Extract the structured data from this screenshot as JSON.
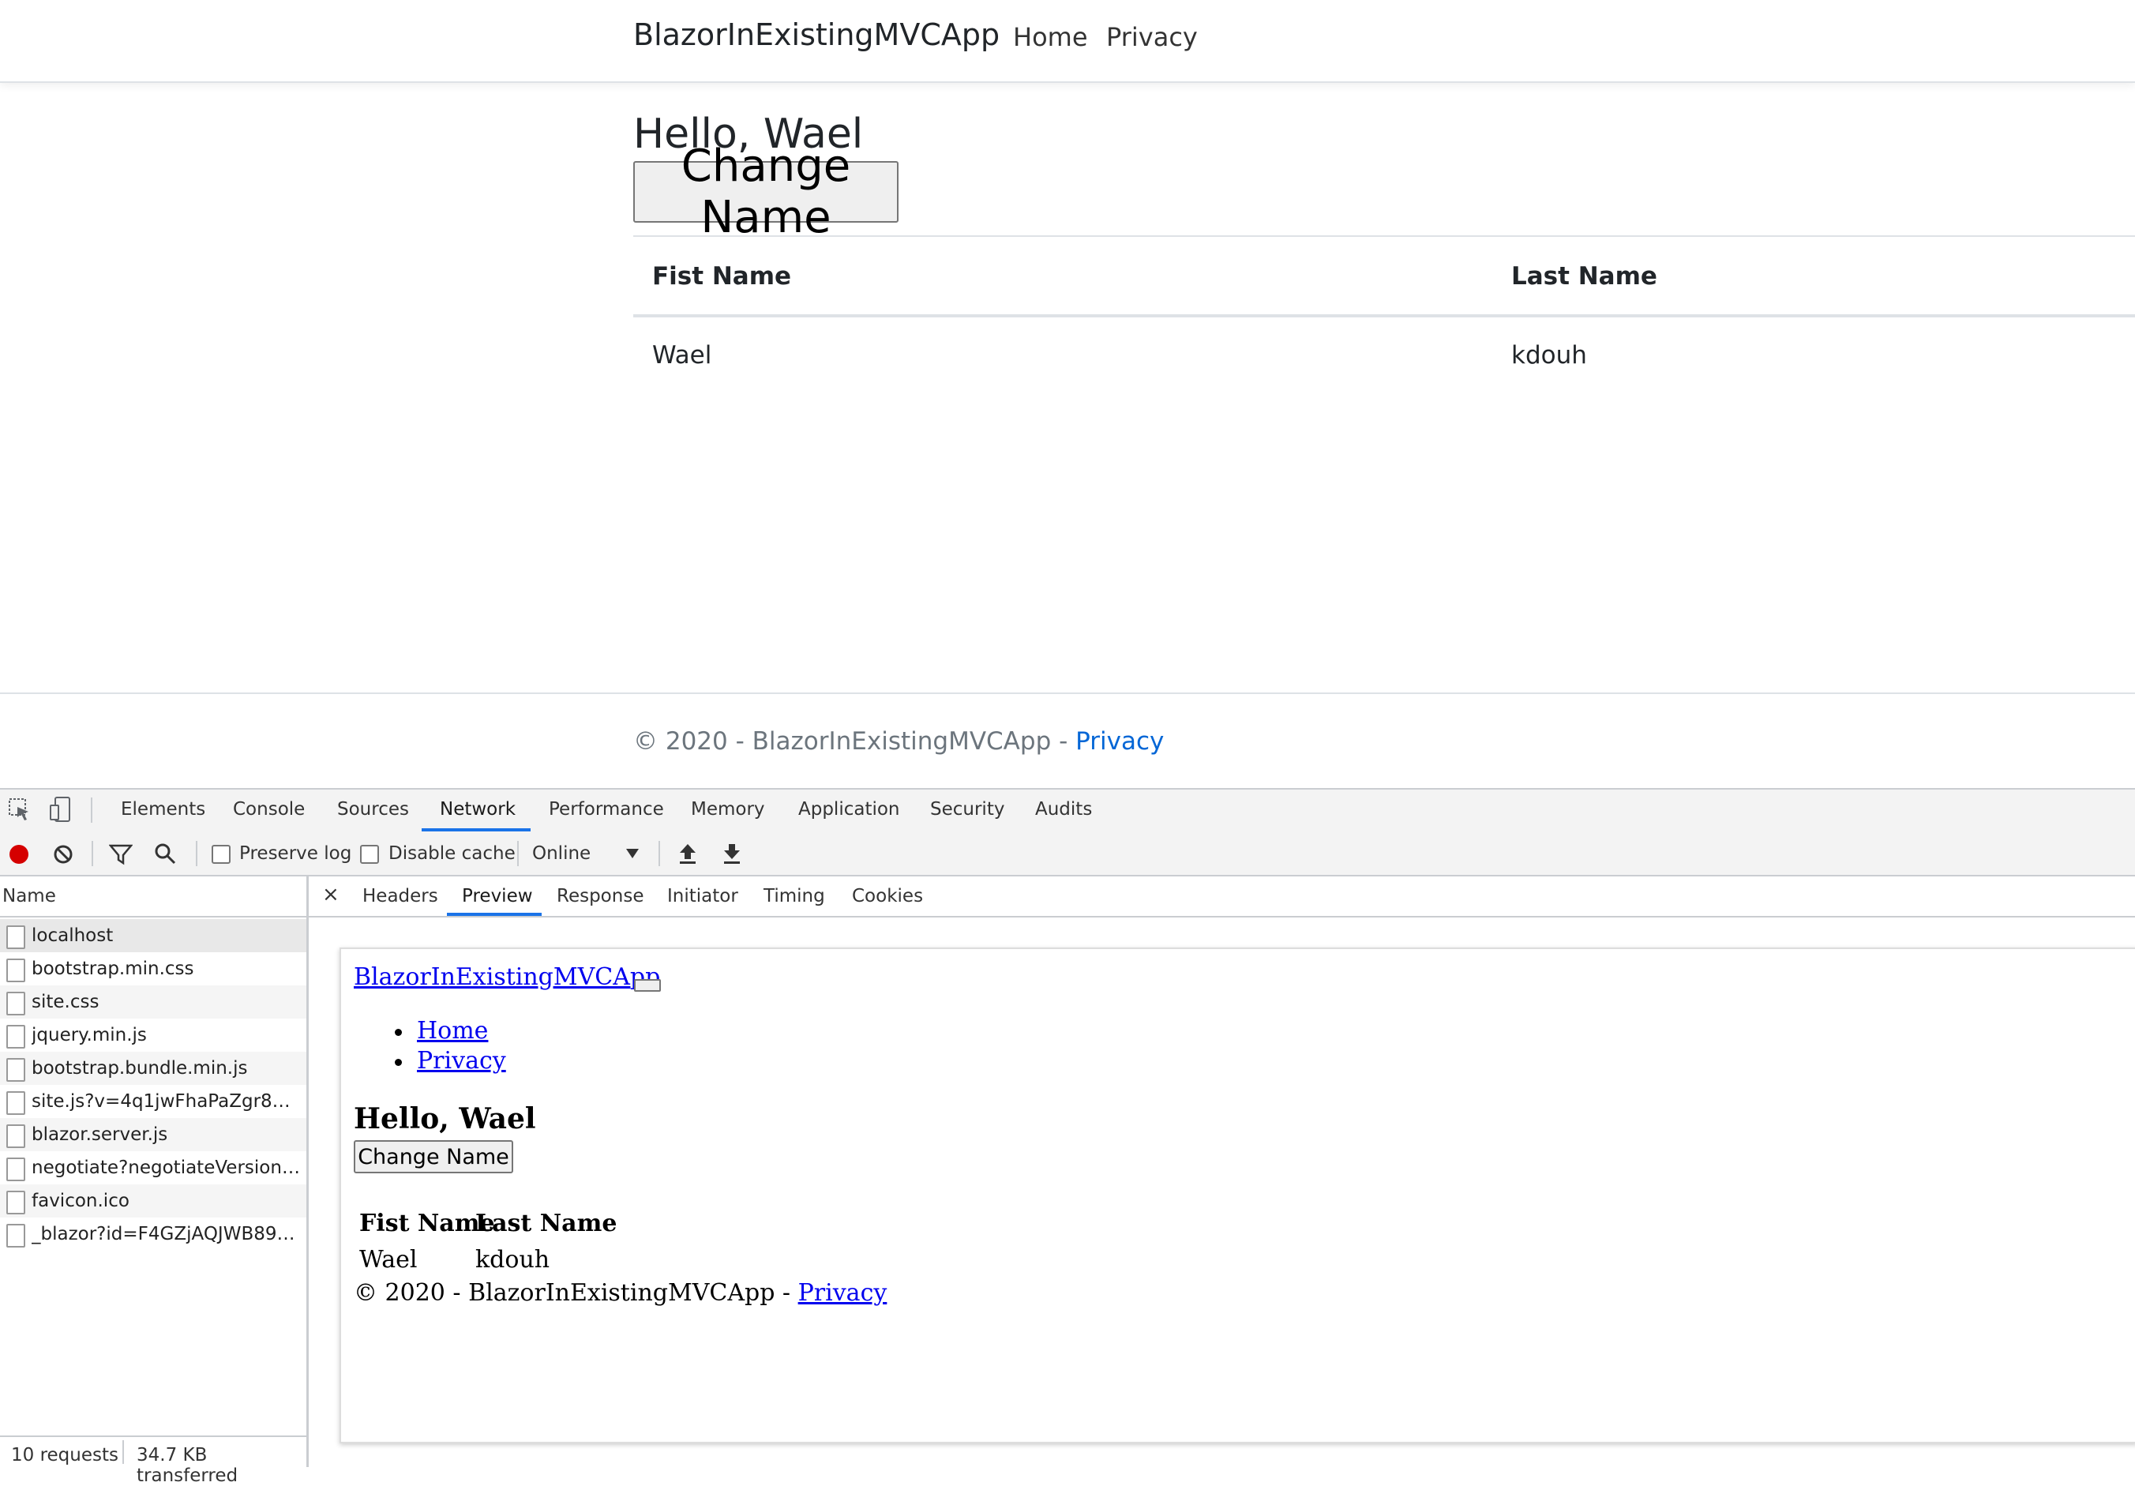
{
  "app": {
    "brand": "BlazorInExistingMVCApp",
    "nav": [
      "Home",
      "Privacy"
    ],
    "greeting": "Hello, Wael",
    "change_button": "Change Name",
    "table": {
      "headers": [
        "Fist Name",
        "Last Name"
      ],
      "rows": [
        [
          "Wael",
          "kdouh"
        ]
      ]
    },
    "footer_prefix": "© 2020 - BlazorInExistingMVCApp - ",
    "footer_link": "Privacy"
  },
  "devtools": {
    "tabs": [
      "Elements",
      "Console",
      "Sources",
      "Network",
      "Performance",
      "Memory",
      "Application",
      "Security",
      "Audits"
    ],
    "active_tab": "Network",
    "toolbar": {
      "preserve_log": "Preserve log",
      "disable_cache": "Disable cache",
      "throttle": "Online"
    },
    "name_header": "Name",
    "requests": [
      "localhost",
      "bootstrap.min.css",
      "site.css",
      "jquery.min.js",
      "bootstrap.bundle.min.js",
      "site.js?v=4q1jwFhaPaZgr8WA...",
      "blazor.server.js",
      "negotiate?negotiateVersion=1",
      "favicon.ico",
      "_blazor?id=F4GZjAQJWB89d8..."
    ],
    "selected_request": "localhost",
    "status": {
      "requests": "10 requests",
      "transferred": "34.7 KB transferred"
    },
    "detail_tabs": [
      "Headers",
      "Preview",
      "Response",
      "Initiator",
      "Timing",
      "Cookies"
    ],
    "active_detail_tab": "Preview",
    "close_symbol": "×",
    "preview": {
      "brand": "BlazorInExistingMVCApp",
      "nav": [
        "Home",
        "Privacy"
      ],
      "greeting": "Hello, Wael",
      "change_button": "Change Name",
      "table_headers": [
        "Fist Name",
        "Last Name"
      ],
      "table_row": [
        "Wael",
        "kdouh"
      ],
      "footer_prefix": "© 2020 - BlazorInExistingMVCApp - ",
      "footer_link": "Privacy"
    }
  }
}
